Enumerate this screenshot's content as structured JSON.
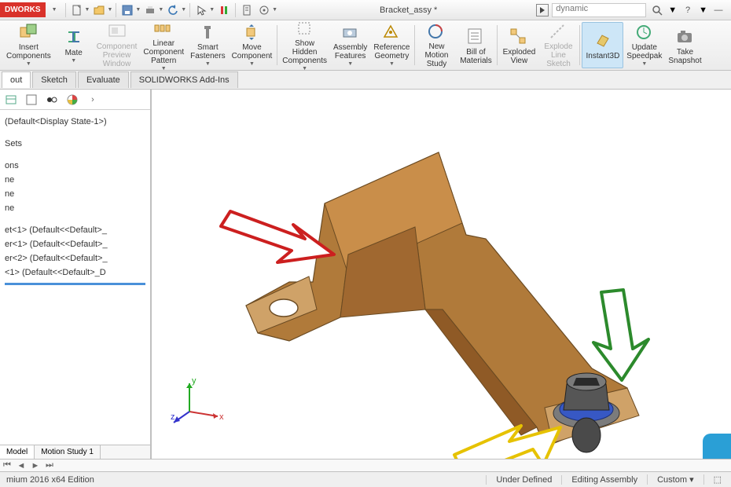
{
  "app": {
    "brand": "DWORKS"
  },
  "document_title": "Bracket_assy *",
  "search": {
    "value": "dynamic",
    "placeholder": "Search"
  },
  "ribbon": [
    {
      "key": "insert-components",
      "label": "Insert\nComponents",
      "drop": true
    },
    {
      "key": "mate",
      "label": "Mate",
      "drop": true
    },
    {
      "key": "component-preview",
      "label": "Component\nPreview\nWindow",
      "disabled": true
    },
    {
      "key": "linear-pattern",
      "label": "Linear\nComponent\nPattern",
      "drop": true
    },
    {
      "key": "smart-fasteners",
      "label": "Smart\nFasteners",
      "drop": true
    },
    {
      "key": "move-component",
      "label": "Move\nComponent",
      "drop": true
    },
    {
      "key": "show-hidden",
      "label": "Show\nHidden\nComponents",
      "drop": true
    },
    {
      "key": "assembly-features",
      "label": "Assembly\nFeatures",
      "drop": true
    },
    {
      "key": "reference-geometry",
      "label": "Reference\nGeometry",
      "drop": true
    },
    {
      "key": "new-motion",
      "label": "New\nMotion\nStudy"
    },
    {
      "key": "bom",
      "label": "Bill of\nMaterials"
    },
    {
      "key": "exploded-view",
      "label": "Exploded\nView"
    },
    {
      "key": "explode-line",
      "label": "Explode\nLine\nSketch",
      "disabled": true
    },
    {
      "key": "instant3d",
      "label": "Instant3D",
      "active": true
    },
    {
      "key": "update-speedpak",
      "label": "Update\nSpeedpak",
      "drop": true
    },
    {
      "key": "take-snapshot",
      "label": "Take\nSnapshot"
    }
  ],
  "tabs": {
    "list": [
      "out",
      "Sketch",
      "Evaluate",
      "SOLIDWORKS Add-Ins"
    ],
    "active": "out"
  },
  "tree": {
    "root": " (Default<Display State-1>)",
    "items": [
      "Sets",
      "ons",
      "ne",
      "ne",
      "ne"
    ],
    "parts": [
      "et<1> (Default<<Default>_",
      "er<1> (Default<<Default>_",
      "er<2> (Default<<Default>_",
      "<1> (Default<<Default>_D"
    ]
  },
  "bottom_tabs": {
    "active": "Model",
    "other": "Motion Study 1"
  },
  "status": {
    "edition": "mium 2016 x64 Edition",
    "under": "Under Defined",
    "editing": "Editing Assembly",
    "custom": "Custom"
  },
  "triad": {
    "x": "x",
    "y": "y",
    "z": "z"
  },
  "hud_icons": [
    "zoom",
    "rotate",
    "prev",
    "section",
    "display-style",
    "hide-show",
    "edit-appearance",
    "apply-scene",
    "view-orient",
    "settings"
  ]
}
